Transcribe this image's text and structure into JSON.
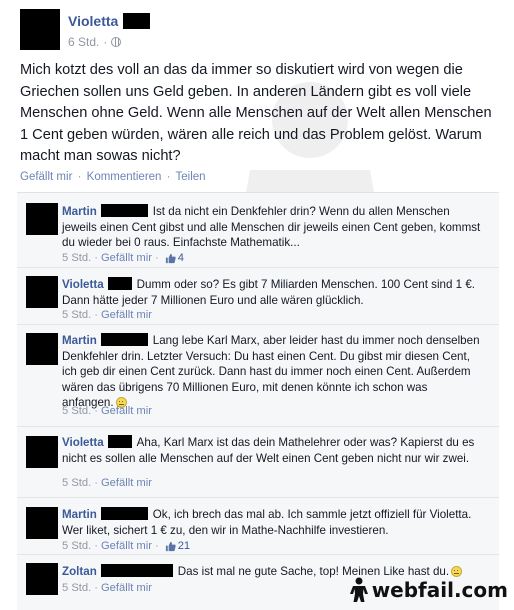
{
  "post": {
    "author": "Violetta",
    "time": "6 Std.",
    "text": "Mich kotzt des voll an das da immer so diskutiert wird von wegen die Griechen sollen uns Geld geben. In anderen Ländern gibt es voll viele Menschen ohne Geld. Wenn alle Menschen auf der Welt allen Menschen 1 Cent geben würden, wären alle reich und das Problem gelöst. Warum macht man sowas nicht?",
    "actions": {
      "like": "Gefällt mir",
      "comment": "Kommentieren",
      "share": "Teilen"
    }
  },
  "comments": [
    {
      "author": "Martin",
      "text": "Ist da nicht ein Denkfehler drin? Wenn du allen Menschen jeweils einen Cent gibst und alle Menschen dir jeweils einen Cent geben, kommst du wieder bei 0 raus. Einfachste Mathematik...",
      "time": "5 Std.",
      "like_label": "Gefällt mir",
      "likes": "4"
    },
    {
      "author": "Violetta",
      "text": "Dumm oder so? Es gibt 7 Miliarden Menschen. 100 Cent sind 1 €. Dann hätte jeder 7 Millionen Euro und alle wären glücklich.",
      "time": "5 Std.",
      "like_label": "Gefällt mir"
    },
    {
      "author": "Martin",
      "text": "Lang lebe Karl Marx, aber leider hast du immer noch denselben Denkfehler drin. Letzter Versuch: Du hast einen Cent. Du gibst mir diesen Cent, ich geb dir einen Cent zurück. Dann hast du immer noch einen Cent. Außerdem wären das übrigens 70 Millionen Euro, mit denen könnte ich schon was anfangen.",
      "time": "5 Std.",
      "like_label": "Gefällt mir"
    },
    {
      "author": "Violetta",
      "text": "Aha, Karl Marx ist das dein Mathelehrer oder was? Kapierst du es nicht es sollen alle Menschen auf der Welt einen Cent geben nicht nur wir zwei.",
      "time": "5 Std.",
      "like_label": "Gefällt mir"
    },
    {
      "author": "Martin",
      "text": "Ok, ich brech das mal ab. Ich sammle jetzt offiziell für Violetta. Wer liket, sichert 1 € zu, den wir in Mathe-Nachhilfe investieren.",
      "time": "5 Std.",
      "like_label": "Gefällt mir",
      "likes": "21"
    },
    {
      "author": "Zoltan",
      "text": "Das ist mal ne gute Sache, top! Meinen Like hast du.",
      "time": "5 Std.",
      "like_label": "Gefällt mir"
    }
  ],
  "separator": "·",
  "watermark_brand": "webfail.com",
  "colors": {
    "link": "#3b5998",
    "meta": "#9197a3",
    "comment_bg": "#f6f7f9"
  }
}
